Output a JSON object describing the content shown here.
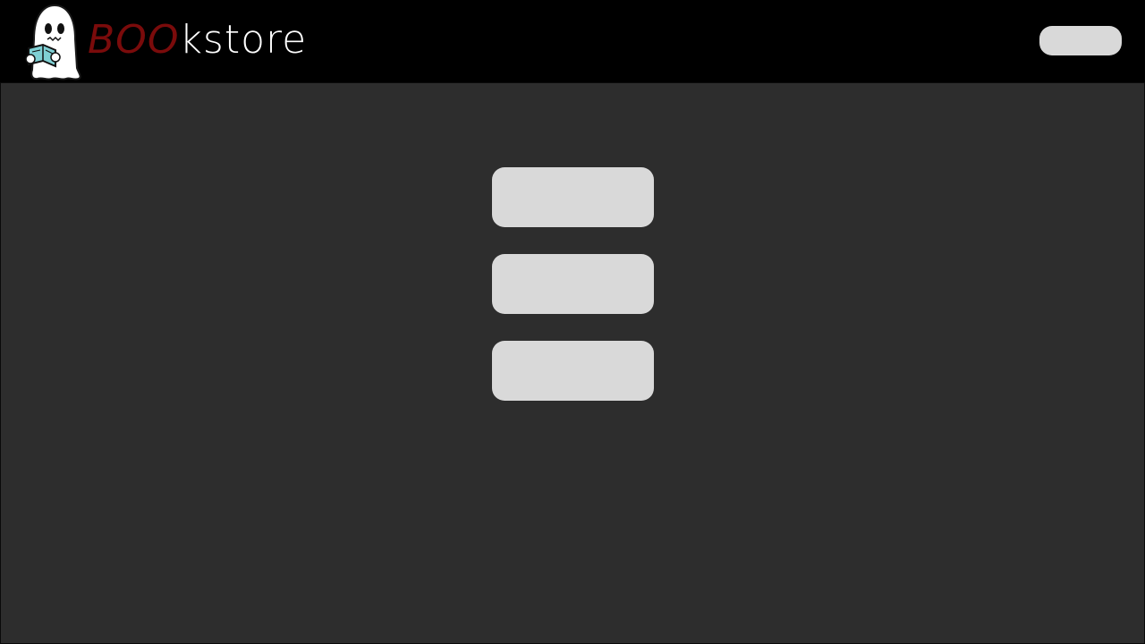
{
  "header": {
    "brand": {
      "highlight": "BOO",
      "rest": "kstore",
      "highlight_color": "#7a0b0b",
      "rest_color": "#ffffff"
    },
    "logo_icon": "ghost-reading-book-icon",
    "account_button_label": ""
  },
  "main": {
    "buttons": [
      {
        "label": ""
      },
      {
        "label": ""
      },
      {
        "label": ""
      }
    ]
  },
  "colors": {
    "header_bg": "#000000",
    "main_bg": "#2d2d2d",
    "button_bg": "#d9d9d9"
  }
}
